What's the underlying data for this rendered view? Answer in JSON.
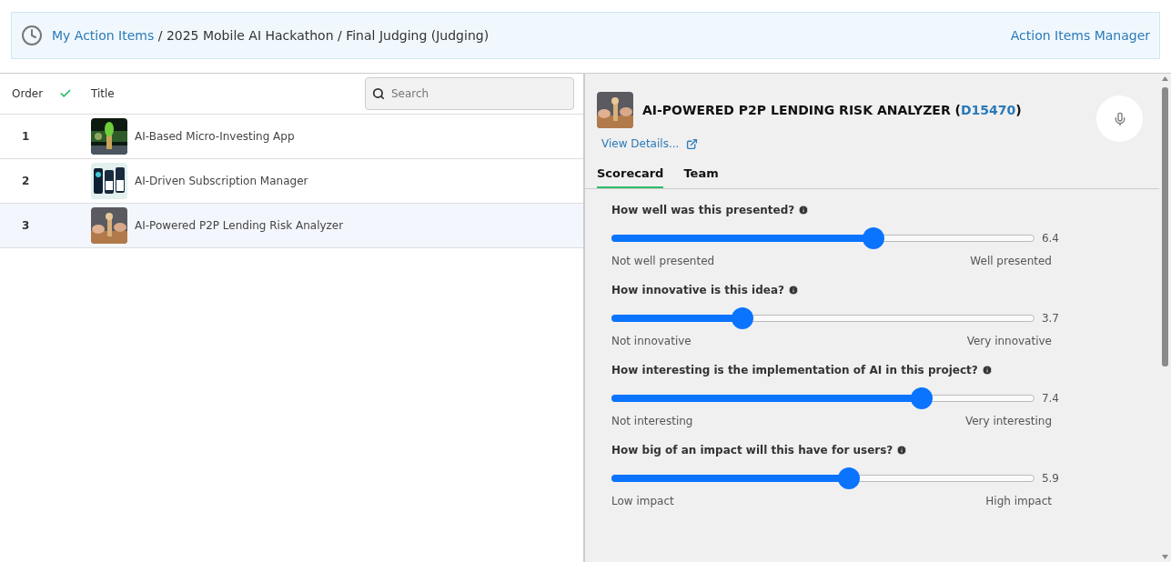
{
  "breadcrumb": {
    "link": "My Action Items",
    "path": " / 2025 Mobile AI Hackathon / Final Judging (Judging)",
    "manager_link": "Action Items Manager"
  },
  "list": {
    "columns": {
      "order": "Order",
      "title": "Title"
    },
    "search": {
      "placeholder": "Search"
    },
    "rows": [
      {
        "order": "1",
        "title": "AI-Based Micro-Investing App",
        "selected": false,
        "kind": "plant"
      },
      {
        "order": "2",
        "title": "AI-Driven Subscription Manager",
        "selected": false,
        "kind": "phones"
      },
      {
        "order": "3",
        "title": "AI-Powered P2P Lending Risk Analyzer",
        "selected": true,
        "kind": "hands"
      }
    ]
  },
  "detail": {
    "title": "AI-POWERED P2P LENDING RISK ANALYZER (",
    "code": "D15470",
    "title_end": ")",
    "view_details": "View Details...",
    "tabs": [
      {
        "label": "Scorecard",
        "selected": true
      },
      {
        "label": "Team",
        "selected": false
      }
    ],
    "questions": [
      {
        "question": "How well was this presented?",
        "level": 0.6,
        "reading": "6.4",
        "low": "Not well presented",
        "high": "Well presented"
      },
      {
        "question": "How innovative is this idea?",
        "level": 0.3,
        "reading": "3.7",
        "low": "Not innovative",
        "high": "Very innovative"
      },
      {
        "question": "How interesting is the implementation of AI in this project?",
        "level": 0.711,
        "reading": "7.4",
        "low": "Not interesting",
        "high": "Very interesting"
      },
      {
        "question": "How big of an impact will this have for users?",
        "level": 0.544,
        "reading": "5.9",
        "low": "Low impact",
        "high": "High impact"
      }
    ]
  }
}
